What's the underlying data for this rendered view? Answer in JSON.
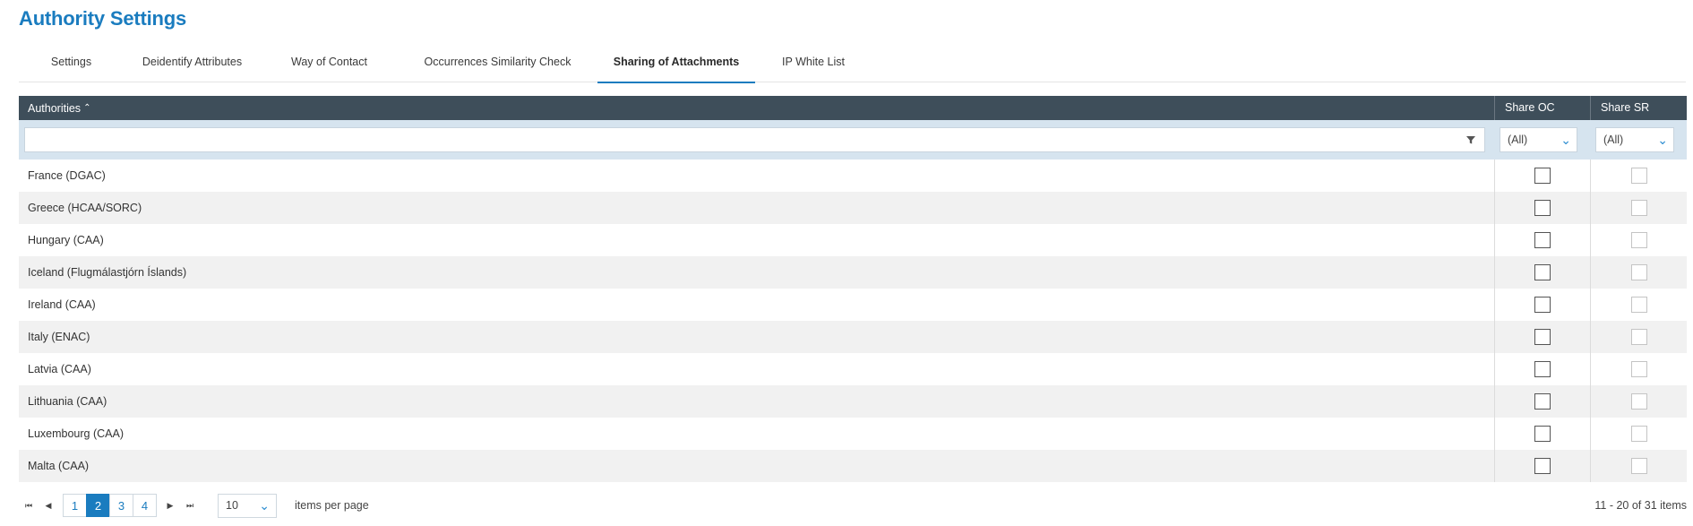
{
  "page": {
    "title": "Authority Settings"
  },
  "tabs": [
    {
      "label": "Settings",
      "active": false
    },
    {
      "label": "Deidentify Attributes",
      "active": false
    },
    {
      "label": "Way of Contact",
      "active": false
    },
    {
      "label": "Occurrences Similarity Check",
      "active": false
    },
    {
      "label": "Sharing of Attachments",
      "active": true
    },
    {
      "label": "IP White List",
      "active": false
    }
  ],
  "grid": {
    "columns": {
      "authorities": "Authorities",
      "share_oc": "Share OC",
      "share_sr": "Share SR"
    },
    "sort_icon": "chevron-up",
    "filters": {
      "authorities_value": "",
      "share_oc": "(All)",
      "share_sr": "(All)"
    },
    "rows": [
      {
        "authority": "France (DGAC)",
        "share_oc": false,
        "share_sr": false
      },
      {
        "authority": "Greece (HCAA/SORC)",
        "share_oc": false,
        "share_sr": false
      },
      {
        "authority": "Hungary (CAA)",
        "share_oc": false,
        "share_sr": false
      },
      {
        "authority": "Iceland (Flugmálastjórn Íslands)",
        "share_oc": false,
        "share_sr": false
      },
      {
        "authority": "Ireland (CAA)",
        "share_oc": false,
        "share_sr": false
      },
      {
        "authority": "Italy (ENAC)",
        "share_oc": false,
        "share_sr": false
      },
      {
        "authority": "Latvia (CAA)",
        "share_oc": false,
        "share_sr": false
      },
      {
        "authority": "Lithuania (CAA)",
        "share_oc": false,
        "share_sr": false
      },
      {
        "authority": "Luxembourg (CAA)",
        "share_oc": false,
        "share_sr": false
      },
      {
        "authority": "Malta (CAA)",
        "share_oc": false,
        "share_sr": false
      }
    ]
  },
  "pager": {
    "pages": [
      "1",
      "2",
      "3",
      "4"
    ],
    "current_page": "2",
    "page_size": "10",
    "page_size_label": "items per page",
    "info": "11 - 20 of 31 items"
  },
  "colors": {
    "accent": "#1a7cbf",
    "header_bg": "#3e4e5a",
    "filter_bg": "#d6e4ef"
  }
}
